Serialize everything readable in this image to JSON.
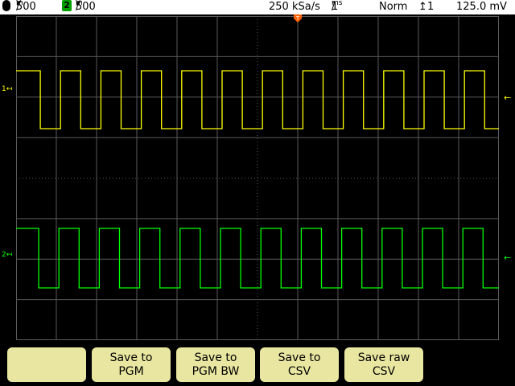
{
  "header": {
    "ch1_scale": "500",
    "ch1_unit_top": "m",
    "ch1_unit_bottom": "V",
    "ch2_badge": "2",
    "ch2_scale": "500",
    "ch2_unit_top": "m",
    "ch2_unit_bottom": "V",
    "sample_rate": "250 kSa/s",
    "timebase": "1",
    "timebase_unit_top": "ms",
    "timebase_unit_bottom": "",
    "trigger_mode": "Norm",
    "trigger_source": "1",
    "trigger_level": "125.0 mV"
  },
  "channels": [
    {
      "name": "1",
      "color": "#ffff00"
    },
    {
      "name": "2",
      "color": "#00ff00"
    }
  ],
  "softkeys": [
    {
      "line1": "",
      "line2": ""
    },
    {
      "line1": "Save to",
      "line2": "PGM"
    },
    {
      "line1": "Save to",
      "line2": "PGM BW"
    },
    {
      "line1": "Save to",
      "line2": "CSV"
    },
    {
      "line1": "Save raw",
      "line2": "CSV"
    }
  ],
  "colors": {
    "grid": "#5a5a5a",
    "softkey_bg": "#e8e6a0",
    "trigger_marker": "#ff6000"
  }
}
